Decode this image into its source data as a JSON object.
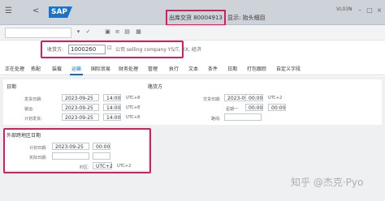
{
  "topbar": {
    "back": "<",
    "logo": "SAP",
    "title_doc": "出库交货 80004913",
    "title_rest": "显示: 抬头细目",
    "tcode": "VL03N"
  },
  "header": {
    "shipping_point_label": "收货方:",
    "shipping_point_value": "1000260",
    "description": "公司 selling company YS/T, XX, 经济"
  },
  "tabs": [
    "正在处理",
    "拣配",
    "装载",
    "运输",
    "国际贸易",
    "财务处理",
    "管理",
    "执行",
    "文本",
    "条件",
    "日期",
    "打包跟踪",
    "自定义字段"
  ],
  "active_tab": "运输",
  "dates": {
    "section_title": "日期",
    "rows": [
      {
        "label": "发货日期:",
        "date": "2023-09-25",
        "time": "14:00",
        "tz": "UTC+8"
      },
      {
        "label": "装运:",
        "date": "2023-09-25",
        "time": "14:00",
        "tz": "UTC+8"
      },
      {
        "label": "计划发货:",
        "date": "2023-09-25",
        "time": "14:00",
        "tz": "UTC+8"
      }
    ]
  },
  "routing": {
    "section_title": "路货方",
    "row1_label": "交货日期:",
    "row1_date": "2023-09-25",
    "row1_time": "00:00",
    "row1_tz": "UTC+2",
    "row2_label": "星期一",
    "row2_time": "00:00",
    "row2_time2": "00:00",
    "row3_label": "路线:"
  },
  "external": {
    "section_title": "外部跨地区日期",
    "row1_label": "计划日期:",
    "row1_date": "2023-09-25",
    "row1_time": "00:00",
    "row2_label": "实际日期:",
    "row3_label": "时区:",
    "row3_tz": "UTC+2",
    "row3_tz2": "UTC+2"
  },
  "watermark": "知乎 @杰克·Pyo"
}
